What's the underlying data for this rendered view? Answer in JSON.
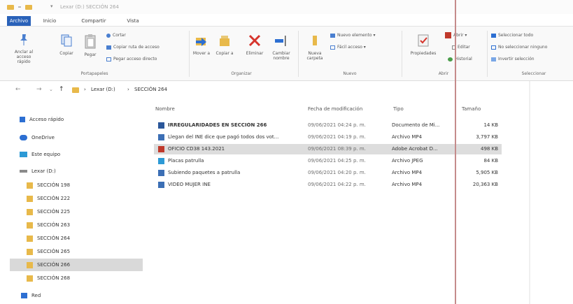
{
  "window": {
    "title": "Lexar (D:) SECCIÓN 264"
  },
  "tabs": [
    {
      "label": "Archivo"
    },
    {
      "label": "Inicio"
    },
    {
      "label": "Compartir"
    },
    {
      "label": "Vista"
    }
  ],
  "ribbon": {
    "portapapeles": {
      "pin": "Anclar al acceso rápido",
      "copy": "Copiar",
      "paste": "Pegar",
      "cut": "Cortar",
      "copy_path": "Copiar ruta de acceso",
      "paste_shortcut": "Pegar acceso directo",
      "label": "Portapapeles"
    },
    "organizar": {
      "move": "Mover a",
      "copy_to": "Copiar a",
      "delete": "Eliminar",
      "rename": "Cambiar nombre",
      "label": "Organizar"
    },
    "nuevo": {
      "new_folder": "Nueva carpeta",
      "new_item": "Nuevo elemento",
      "easy_access": "Fácil acceso",
      "label": "Nuevo"
    },
    "abrir": {
      "properties": "Propiedades",
      "open": "Abrir",
      "edit": "Editar",
      "history": "Historial",
      "label": "Abrir"
    },
    "seleccionar": {
      "select_all": "Seleccionar todo",
      "select_none": "No seleccionar ninguno",
      "invert": "Invertir selección",
      "label": "Seleccionar"
    }
  },
  "address": {
    "back": "←",
    "forward": "→",
    "dropdown": "⌄",
    "up": "↑",
    "separator": "›",
    "drive": "Lexar (D:)",
    "folder": "SECCIÓN 264"
  },
  "sidebar": {
    "items": [
      {
        "label": "Acceso rápido"
      },
      {
        "label": "OneDrive"
      },
      {
        "label": "Este equipo"
      },
      {
        "label": "Lexar (D:)"
      },
      {
        "label": "SECCIÓN 198"
      },
      {
        "label": "SECCIÓN 222"
      },
      {
        "label": "SECCIÓN 225"
      },
      {
        "label": "SECCIÓN 263"
      },
      {
        "label": "SECCIÓN 264"
      },
      {
        "label": "SECCIÓN 265"
      },
      {
        "label": "SECCIÓN 266"
      },
      {
        "label": "SECCIÓN 268"
      },
      {
        "label": "Red"
      }
    ]
  },
  "columns": {
    "name": "Nombre",
    "date": "Fecha de modificación",
    "type": "Tipo",
    "size": "Tamaño"
  },
  "files": [
    {
      "name": "IRREGULARIDADES EN SECCIÓN 266",
      "date": "09/06/2021 04:24 p. m.",
      "type": "Documento de Mi...",
      "size": "14 KB",
      "icon": "word-icon"
    },
    {
      "name": "Llegan del INE dice que pagó todos dos vot...",
      "date": "09/06/2021 04:19 p. m.",
      "type": "Archivo MP4",
      "size": "3,797 KB",
      "icon": "video-icon"
    },
    {
      "name": "OFICIO CD38 143.2021",
      "date": "09/06/2021 08:39 p. m.",
      "type": "Adobe Acrobat D...",
      "size": "498 KB",
      "icon": "pdf-icon"
    },
    {
      "name": "Placas patrulla",
      "date": "09/06/2021 04:25 p. m.",
      "type": "Archivo JPEG",
      "size": "84 KB",
      "icon": "image-icon"
    },
    {
      "name": "Subiendo paquetes a patrulla",
      "date": "09/06/2021 04:20 p. m.",
      "type": "Archivo MP4",
      "size": "5,905 KB",
      "icon": "video-icon"
    },
    {
      "name": "VIDEO MUJER INE",
      "date": "09/06/2021 04:22 p. m.",
      "type": "Archivo MP4",
      "size": "20,363 KB",
      "icon": "video-icon"
    }
  ]
}
